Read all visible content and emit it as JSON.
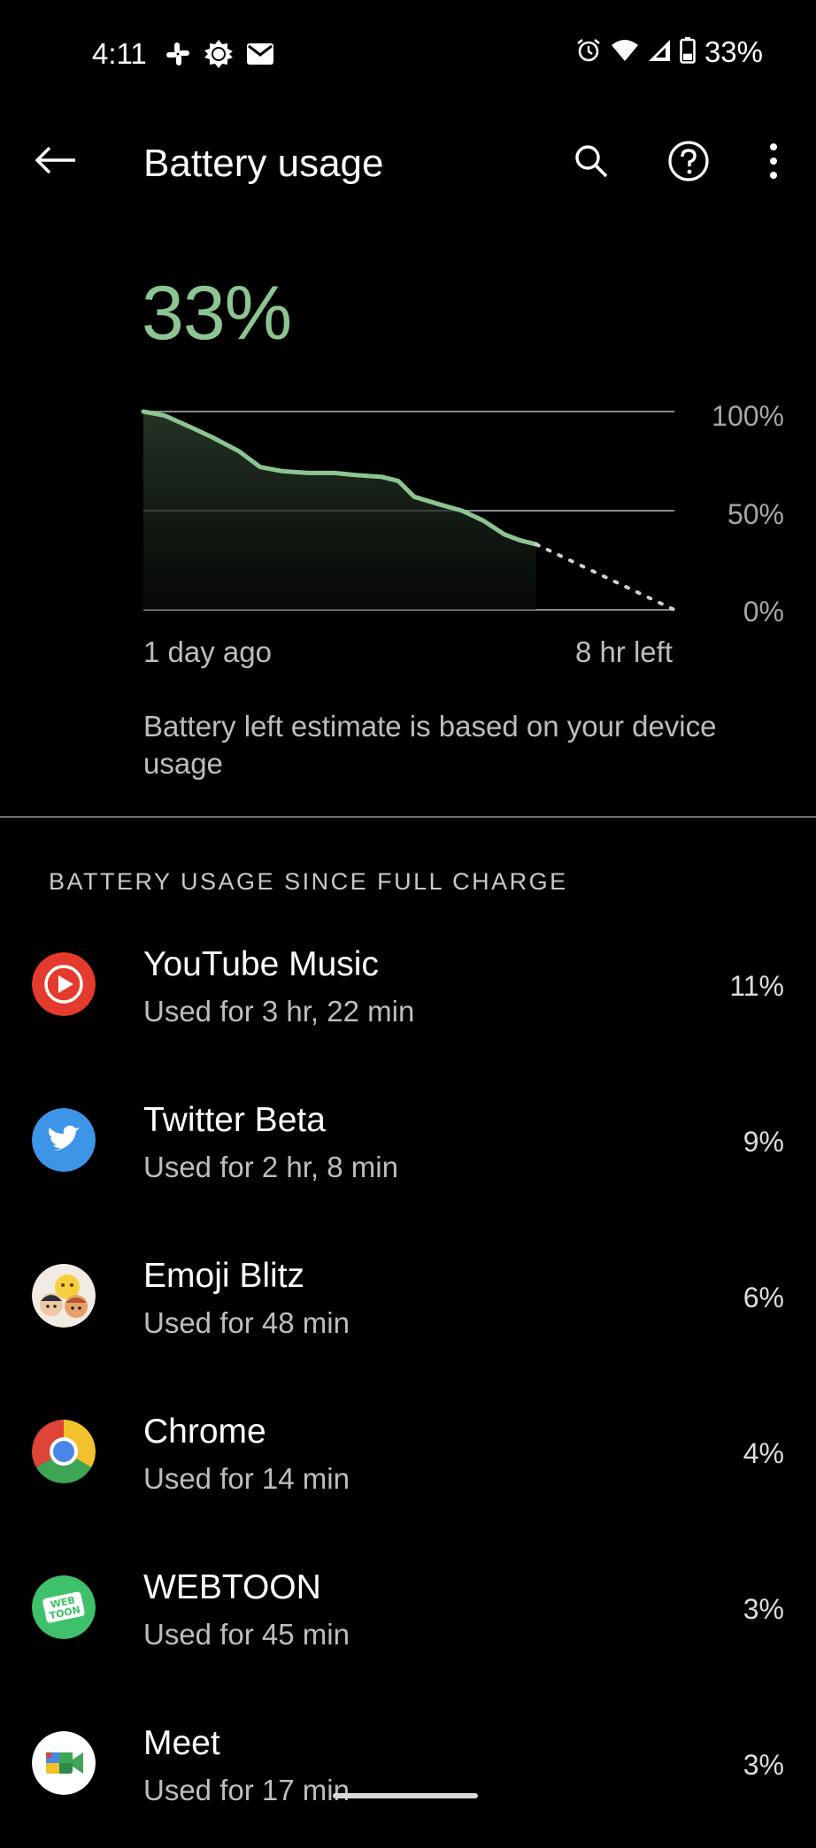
{
  "status_bar": {
    "time": "4:11",
    "battery_text": "33%",
    "left_icons": [
      "slack-icon",
      "brightness-icon",
      "mail-icon"
    ],
    "right_icons": [
      "alarm-icon",
      "wifi-icon",
      "signal-icon",
      "battery-icon"
    ]
  },
  "app_bar": {
    "title": "Battery usage",
    "icons": [
      "back-arrow-icon",
      "search-icon",
      "help-icon",
      "more-vert-icon"
    ]
  },
  "battery": {
    "level": "33%",
    "level_fraction": 0.33,
    "accent_color": "#8dc592"
  },
  "chart": {
    "y_ticks": [
      "100%",
      "50%",
      "0%"
    ],
    "x_start_label": "1 day ago",
    "x_end_label": "8 hr left",
    "note": "Battery left estimate is based on your device usage"
  },
  "chart_data": {
    "type": "area",
    "ylim": [
      0,
      100
    ],
    "y_ticks": [
      100,
      50,
      0
    ],
    "x_range_labels": [
      "1 day ago",
      "8 hr left"
    ],
    "series": [
      {
        "values_history": [
          {
            "t": 0.0,
            "y": 100
          },
          {
            "t": 0.04,
            "y": 98
          },
          {
            "t": 0.09,
            "y": 92
          },
          {
            "t": 0.13,
            "y": 87
          },
          {
            "t": 0.18,
            "y": 80
          },
          {
            "t": 0.22,
            "y": 72
          },
          {
            "t": 0.26,
            "y": 70
          },
          {
            "t": 0.31,
            "y": 69
          },
          {
            "t": 0.36,
            "y": 69
          },
          {
            "t": 0.4,
            "y": 68
          },
          {
            "t": 0.45,
            "y": 67
          },
          {
            "t": 0.48,
            "y": 65
          },
          {
            "t": 0.51,
            "y": 57
          },
          {
            "t": 0.56,
            "y": 53
          },
          {
            "t": 0.6,
            "y": 50
          },
          {
            "t": 0.64,
            "y": 45
          },
          {
            "t": 0.68,
            "y": 38
          },
          {
            "t": 0.71,
            "y": 35
          },
          {
            "t": 0.74,
            "y": 33
          }
        ],
        "values_projection": [
          {
            "t": 0.74,
            "y": 33
          },
          {
            "t": 1.0,
            "y": 0
          }
        ]
      }
    ],
    "grid": true
  },
  "section": {
    "header": "BATTERY USAGE SINCE FULL CHARGE"
  },
  "apps": [
    {
      "name": "YouTube Music",
      "usage": "Used for 3 hr, 22 min",
      "percent": "11%",
      "icon": "youtube-music-icon"
    },
    {
      "name": "Twitter Beta",
      "usage": "Used for 2 hr, 8 min",
      "percent": "9%",
      "icon": "twitter-icon"
    },
    {
      "name": "Emoji Blitz",
      "usage": "Used for 48 min",
      "percent": "6%",
      "icon": "emoji-blitz-icon"
    },
    {
      "name": "Chrome",
      "usage": "Used for 14 min",
      "percent": "4%",
      "icon": "chrome-icon"
    },
    {
      "name": "WEBTOON",
      "usage": "Used for 45 min",
      "percent": "3%",
      "icon": "webtoon-icon",
      "icon_text": "WEB TOON"
    },
    {
      "name": "Meet",
      "usage": "Used for 17 min",
      "percent": "3%",
      "icon": "meet-icon"
    }
  ]
}
